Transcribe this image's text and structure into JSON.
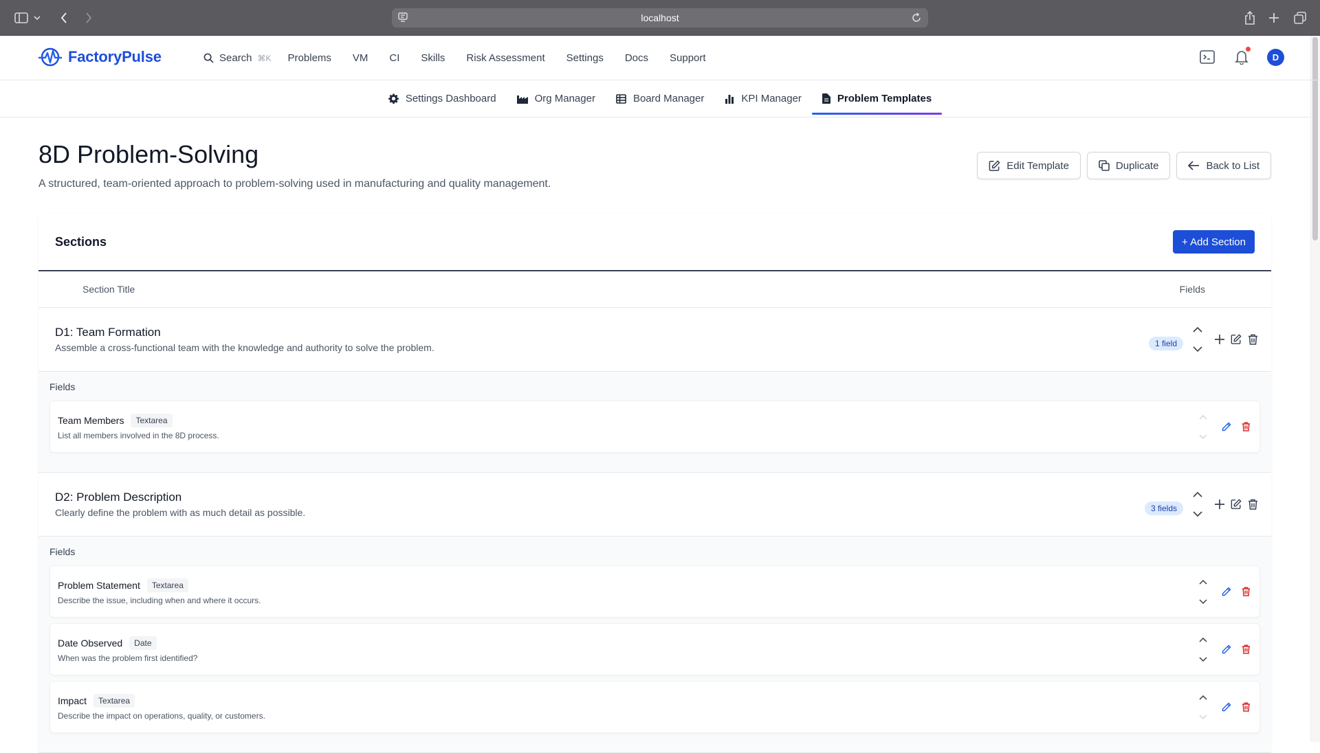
{
  "browser": {
    "url": "localhost"
  },
  "app": {
    "brand": "FactoryPulse",
    "brand_color": "#1d4ed8",
    "search_label": "Search",
    "search_shortcut": "⌘K",
    "nav": [
      "Problems",
      "VM",
      "CI",
      "Skills",
      "Risk Assessment",
      "Settings",
      "Docs",
      "Support"
    ],
    "avatar_initial": "D"
  },
  "subnav": {
    "tabs": [
      {
        "label": "Settings Dashboard",
        "icon": "gear-icon"
      },
      {
        "label": "Org Manager",
        "icon": "factory-icon"
      },
      {
        "label": "Board Manager",
        "icon": "table-icon"
      },
      {
        "label": "KPI Manager",
        "icon": "bar-chart-icon"
      },
      {
        "label": "Problem Templates",
        "icon": "document-icon",
        "active": true
      }
    ]
  },
  "page": {
    "title": "8D Problem-Solving",
    "description": "A structured, team-oriented approach to problem-solving used in manufacturing and quality management.",
    "actions": {
      "edit": "Edit Template",
      "duplicate": "Duplicate",
      "back": "Back to List"
    }
  },
  "sections_card": {
    "title": "Sections",
    "add_button": "+ Add Section",
    "columns": {
      "title": "Section Title",
      "fields": "Fields"
    },
    "fields_label": "Fields",
    "sections": [
      {
        "title": "D1: Team Formation",
        "description": "Assemble a cross-functional team with the knowledge and authority to solve the problem.",
        "badge": "1 field",
        "fields": [
          {
            "name": "Team Members",
            "type": "Textarea",
            "description": "List all members involved in the 8D process."
          }
        ]
      },
      {
        "title": "D2: Problem Description",
        "description": "Clearly define the problem with as much detail as possible.",
        "badge": "3 fields",
        "fields": [
          {
            "name": "Problem Statement",
            "type": "Textarea",
            "description": "Describe the issue, including when and where it occurs."
          },
          {
            "name": "Date Observed",
            "type": "Date",
            "description": "When was the problem first identified?"
          },
          {
            "name": "Impact",
            "type": "Textarea",
            "description": "Describe the impact on operations, quality, or customers."
          }
        ]
      }
    ]
  }
}
